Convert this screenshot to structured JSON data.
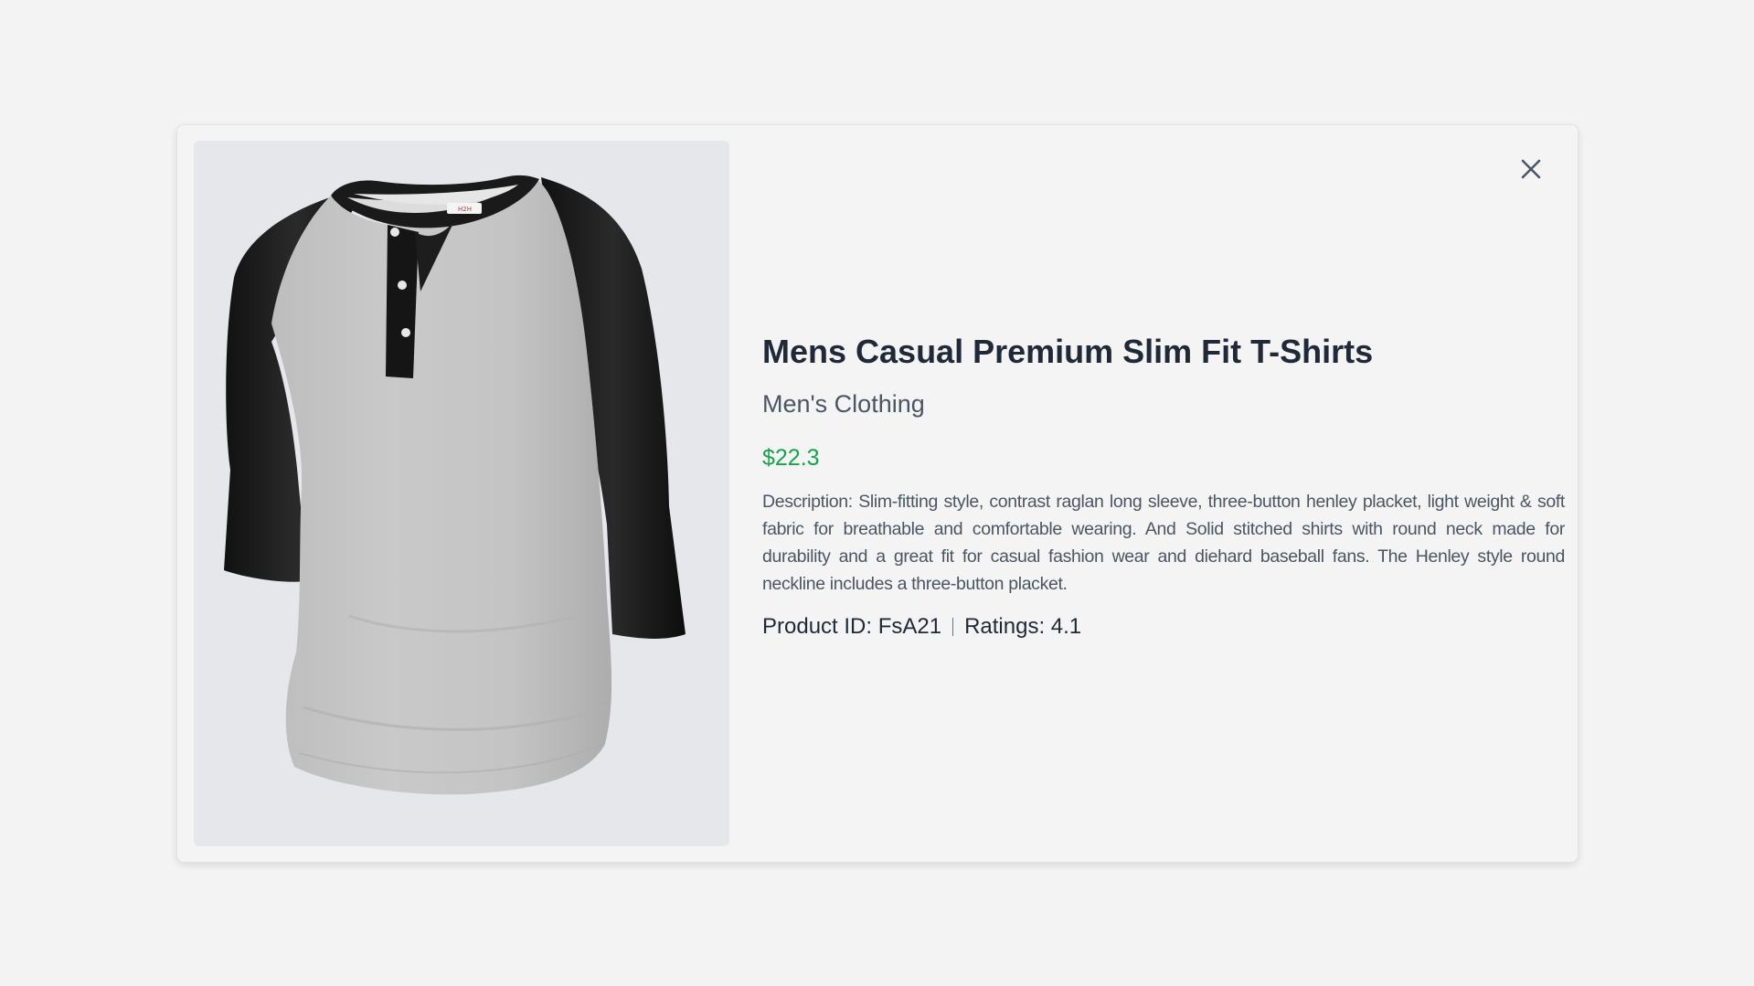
{
  "product": {
    "title": "Mens Casual Premium Slim Fit T-Shirts",
    "category": "Men's Clothing",
    "price": "$22.3",
    "description": "Description: Slim-fitting style, contrast raglan long sleeve, three-button henley placket, light weight & soft fabric for breathable and comfortable wearing. And Solid stitched shirts with round neck made for durability and a great fit for casual fashion wear and diehard baseball fans. The Henley style round neckline includes a three-button placket.",
    "product_id": "Product ID: FsA21",
    "ratings": "Ratings: 4.1",
    "image_label": "H2H"
  },
  "icons": {
    "close": "close-icon"
  },
  "colors": {
    "price": "#16a34a",
    "title": "#1f2937",
    "secondary_text": "#4b5563",
    "image_background": "#e5e7eb"
  }
}
